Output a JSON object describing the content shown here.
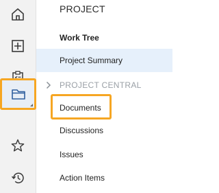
{
  "rail": {
    "icons": [
      {
        "name": "home-icon"
      },
      {
        "name": "add-box-icon"
      },
      {
        "name": "checklist-clipboard-icon"
      },
      {
        "name": "folder-icon",
        "active": true
      },
      {
        "name": "star-icon"
      },
      {
        "name": "history-icon"
      }
    ]
  },
  "panel": {
    "title": "PROJECT",
    "items": [
      {
        "label": "Work Tree"
      },
      {
        "label": "Project Summary"
      },
      {
        "label": "PROJECT CENTRAL"
      },
      {
        "label": "Documents"
      },
      {
        "label": "Discussions"
      },
      {
        "label": "Issues"
      },
      {
        "label": "Action Items"
      }
    ]
  },
  "colors": {
    "highlight": "#f6a623",
    "selected_bg": "#e6f0fb",
    "section_text": "#9aa0a6",
    "rail_bg": "#f2f2f2",
    "icon": "#3a3a3a"
  }
}
